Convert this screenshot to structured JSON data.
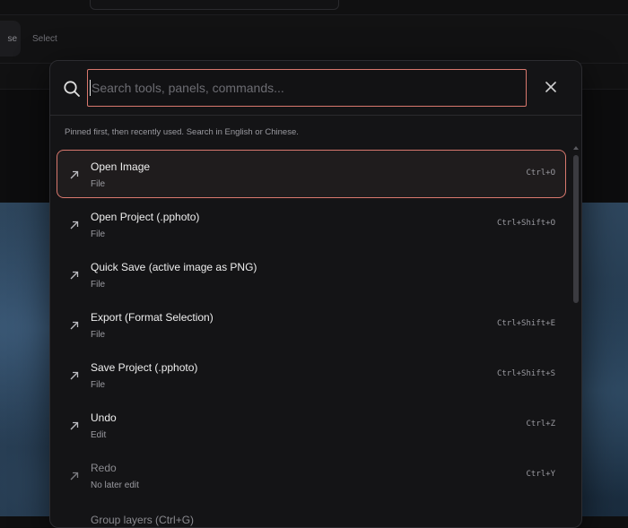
{
  "toolbar": {
    "partial_button_label": "se",
    "select_label": "Select"
  },
  "palette": {
    "search": {
      "placeholder": "Search tools, panels, commands...",
      "value": ""
    },
    "hint": "Pinned first, then recently used. Search in English or Chinese.",
    "items": [
      {
        "title": "Open Image",
        "category": "File",
        "shortcut": "Ctrl+O",
        "active": true
      },
      {
        "title": "Open Project (.pphoto)",
        "category": "File",
        "shortcut": "Ctrl+Shift+O"
      },
      {
        "title": "Quick Save (active image as PNG)",
        "category": "File",
        "shortcut": ""
      },
      {
        "title": "Export (Format Selection)",
        "category": "File",
        "shortcut": "Ctrl+Shift+E"
      },
      {
        "title": "Save Project (.pphoto)",
        "category": "File",
        "shortcut": "Ctrl+Shift+S"
      },
      {
        "title": "Undo",
        "category": "Edit",
        "shortcut": "Ctrl+Z"
      },
      {
        "title": "Redo",
        "category": "No later edit",
        "shortcut": "Ctrl+Y",
        "disabled": true
      },
      {
        "title": "Group layers (Ctrl+G)",
        "category": "",
        "shortcut": "",
        "disabled": true
      }
    ]
  },
  "icons": {
    "search": "search-icon",
    "close": "close-icon",
    "item": "arrow-up-right-icon"
  },
  "colors": {
    "accent": "#d9786e",
    "panel_bg": "#141416",
    "text": "#eeeeee",
    "muted": "#9a9aa0"
  }
}
